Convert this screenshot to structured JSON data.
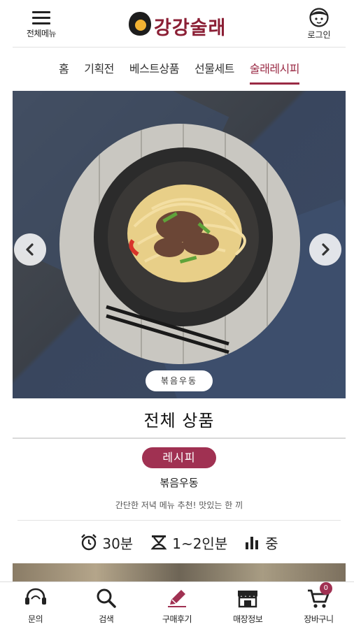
{
  "header": {
    "menu_label": "전체메뉴",
    "logo_text": "강강술래",
    "login_label": "로그인"
  },
  "nav": {
    "items": [
      {
        "label": "홈"
      },
      {
        "label": "기획전"
      },
      {
        "label": "베스트상품"
      },
      {
        "label": "선물세트"
      },
      {
        "label": "술래레시피"
      }
    ],
    "active_index": 4
  },
  "hero": {
    "caption": "볶음우동"
  },
  "section": {
    "title": "전체 상품"
  },
  "recipe": {
    "badge": "레시피",
    "name": "볶음우동",
    "description": "간단한 저녁 메뉴 추천! 맛있는 한 끼",
    "time": "30분",
    "servings": "1~2인분",
    "difficulty": "중"
  },
  "tabbar": {
    "items": [
      {
        "label": "문의",
        "icon": "headset-icon"
      },
      {
        "label": "검색",
        "icon": "search-icon"
      },
      {
        "label": "구매후기",
        "icon": "pencil-icon"
      },
      {
        "label": "매장정보",
        "icon": "store-icon"
      },
      {
        "label": "장바구니",
        "icon": "cart-icon"
      }
    ],
    "cart_count": "0"
  },
  "colors": {
    "brand": "#9a2a44",
    "badge": "#a03152"
  }
}
